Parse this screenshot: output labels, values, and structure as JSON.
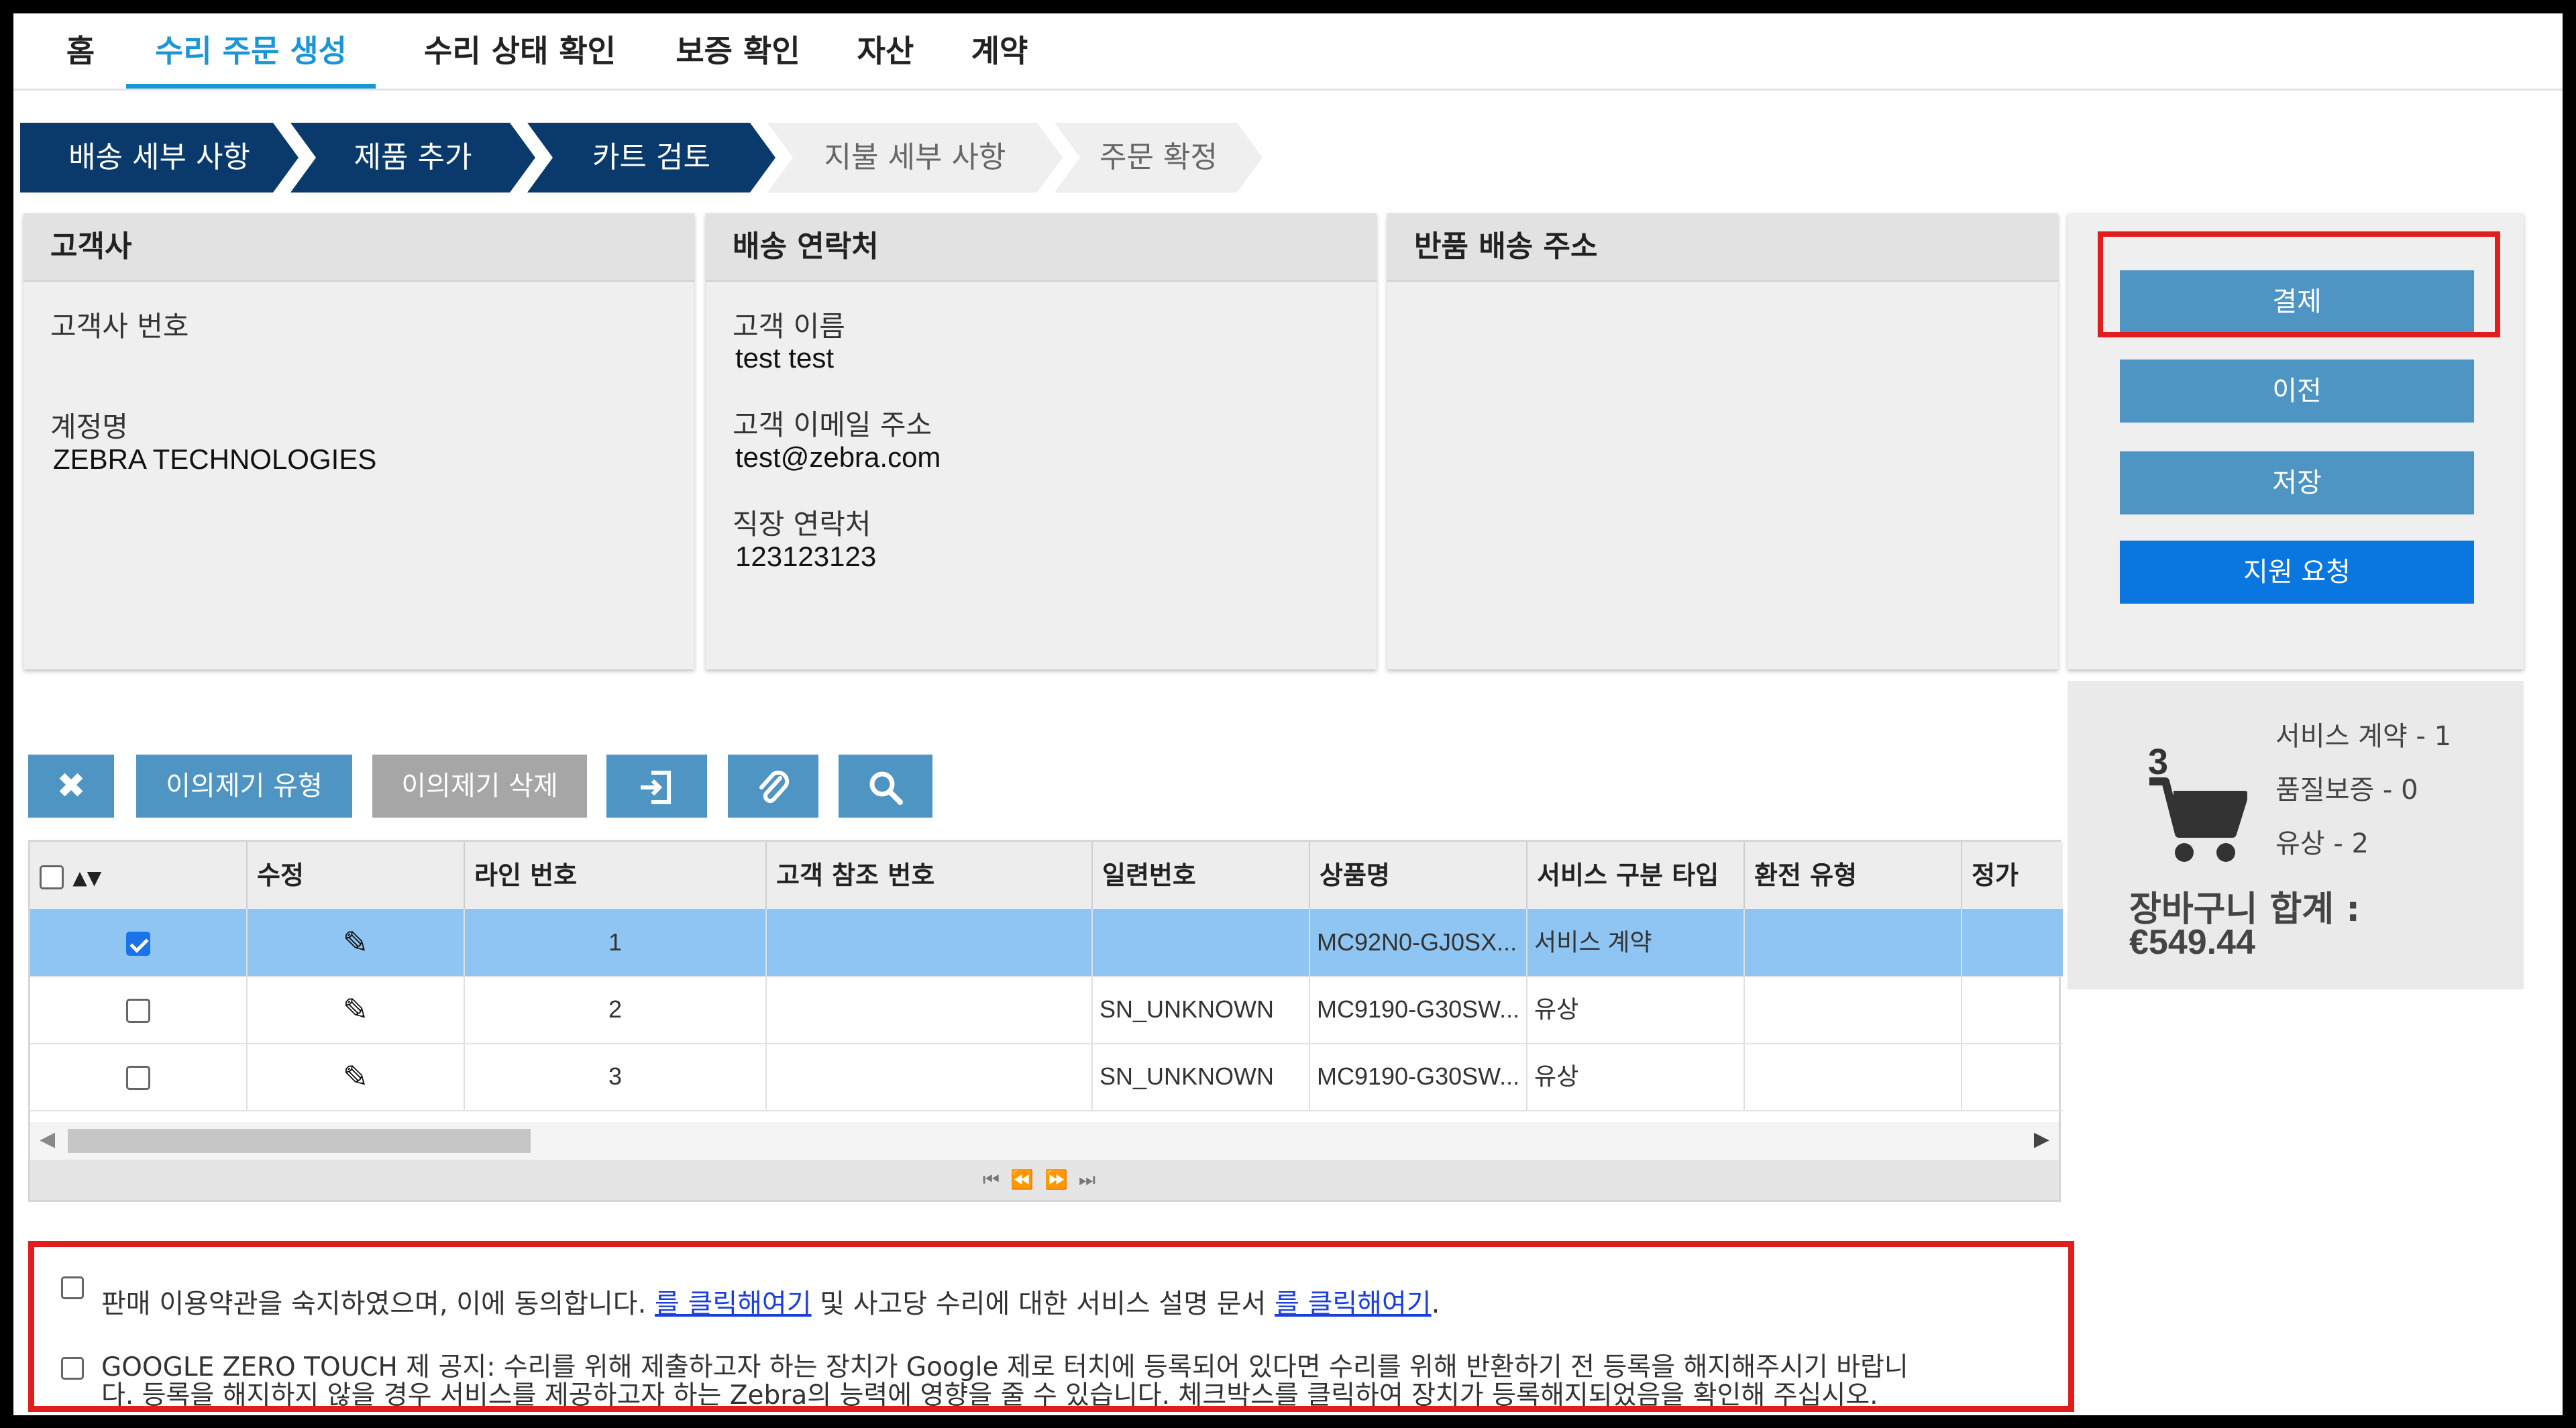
{
  "nav": {
    "items": [
      "홈",
      "수리 주문 생성",
      "수리 상태 확인",
      "보증 확인",
      "자산",
      "계약"
    ],
    "active_index": 1
  },
  "steps": [
    {
      "label": "배송 세부 사항",
      "state": "done"
    },
    {
      "label": "제품 추가",
      "state": "done"
    },
    {
      "label": "카트 검토",
      "state": "current"
    },
    {
      "label": "지불 세부 사항",
      "state": "todo"
    },
    {
      "label": "주문 확정",
      "state": "todo"
    }
  ],
  "customer": {
    "title": "고객사",
    "number_label": "고객사 번호",
    "number_value": "",
    "account_label": "계정명",
    "account_value": "ZEBRA TECHNOLOGIES"
  },
  "contact": {
    "title": "배송 연락처",
    "name_label": "고객 이름",
    "name_value": "test test",
    "email_label": "고객 이메일 주소",
    "email_value": "test@zebra.com",
    "phone_label": "직장 연락처",
    "phone_value": "123123123"
  },
  "return_address": {
    "title": "반품 배송 주소"
  },
  "actions": {
    "pay": "결제",
    "prev": "이전",
    "save": "저장",
    "support": "지원 요청"
  },
  "cart": {
    "count": "3",
    "service_contract": "서비스 계약 - 1",
    "warranty": "품질보증 - 0",
    "paid": "유상 - 2",
    "total_label": "장바구니 합계 :",
    "total_value": "€549.44"
  },
  "toolbar": {
    "complaint_type": "이의제기 유형",
    "complaint_delete": "이의제기 삭제"
  },
  "table": {
    "headers": [
      "",
      "수정",
      "라인 번호",
      "고객 참조 번호",
      "일련번호",
      "상품명",
      "서비스 구분 타입",
      "환전 유형",
      "정가"
    ],
    "rows": [
      {
        "checked": true,
        "line": "1",
        "ref": "",
        "serial": "",
        "product": "MC92N0-GJ0SX...",
        "service": "서비스 계약",
        "exchange": "",
        "price": ""
      },
      {
        "checked": false,
        "line": "2",
        "ref": "",
        "serial": "SN_UNKNOWN",
        "product": "MC9190-G30SW...",
        "service": "유상",
        "exchange": "",
        "price": ""
      },
      {
        "checked": false,
        "line": "3",
        "ref": "",
        "serial": "SN_UNKNOWN",
        "product": "MC9190-G30SW...",
        "service": "유상",
        "exchange": "",
        "price": ""
      }
    ]
  },
  "terms": {
    "line1_a": "판매 이용약관을 숙지하였으며, 이에 동의합니다. ",
    "line1_link1": "를 클릭해여기",
    "line1_b": " 및 사고당 수리에 대한 서비스 설명 문서 ",
    "line1_link2": "를 클릭해여기",
    "line1_c": ".",
    "line2": "GOOGLE ZERO TOUCH 제 공지: 수리를 위해 제출하고자 하는 장치가 Google 제로 터치에 등록되어 있다면 수리를 위해 반환하기 전 등록을 해지해주시기 바랍니",
    "line3": "다. 등록을 해지하지 않을 경우 서비스를 제공하고자 하는 Zebra의 능력에 영향을 줄 수 있습니다. 체크박스를 클릭하여 장치가 등록해지되었음을 확인해 주십시오."
  },
  "colors": {
    "accent": "#1a95d6",
    "step_done": "#0a3a6c",
    "button": "#4f95c4",
    "button_primary": "#0a76e0",
    "highlight": "#e21d1d",
    "selected_row": "#8ec5f2"
  }
}
